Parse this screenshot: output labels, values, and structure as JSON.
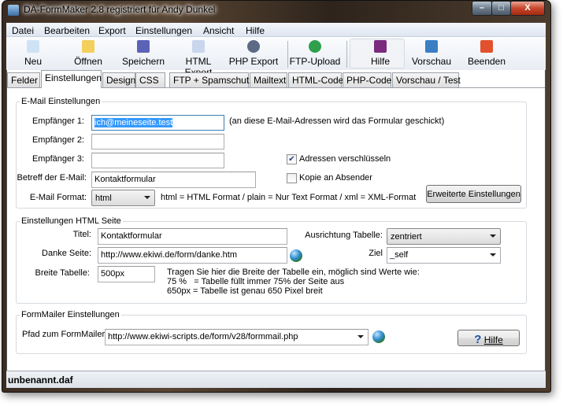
{
  "window": {
    "title": "DA-FormMaker 2.8   registriert für Andy Dunkel",
    "controls": {
      "minimize": "–",
      "maximize": "□",
      "close": "X"
    }
  },
  "menu": [
    "Datei",
    "Bearbeiten",
    "Export",
    "Einstellungen",
    "Ansicht",
    "Hilfe"
  ],
  "toolbar": [
    {
      "label": "Neu",
      "icon": "new-file-icon",
      "color": "#cfe2f5"
    },
    {
      "label": "Öffnen",
      "icon": "open-folder-icon",
      "color": "#f3cf5b"
    },
    {
      "label": "Speichern",
      "icon": "save-disk-icon",
      "color": "#5b63b8"
    },
    {
      "label": "HTML Export",
      "icon": "html-document-icon",
      "color": "#c9d6ee"
    },
    {
      "label": "PHP Export",
      "icon": "php-icon",
      "color": "#5c6a86"
    },
    {
      "label": "FTP-Upload",
      "icon": "upload-globe-icon",
      "color": "#2e9f4a"
    },
    {
      "label": "Hilfe",
      "icon": "help-book-icon",
      "color": "#7a2b7e"
    },
    {
      "label": "Vorschau",
      "icon": "preview-window-icon",
      "color": "#3a7fc4"
    },
    {
      "label": "Beenden",
      "icon": "exit-icon",
      "color": "#e2512d"
    }
  ],
  "tabs": [
    "Felder",
    "Einstellungen",
    "Design",
    "CSS",
    "FTP + Spamschutz",
    "Mailtext",
    "HTML-Code",
    "PHP-Code",
    "Vorschau / Test"
  ],
  "email": {
    "group": "E-Mail Einstellungen",
    "r1_label": "Empfänger 1:",
    "r1_value": "ich@meineseite.test",
    "r1_hint": "(an diese E-Mail-Adressen wird das Formular geschickt)",
    "r2_label": "Empfänger 2:",
    "r2_value": "",
    "r3_label": "Empfänger 3:",
    "r3_value": "",
    "subject_label": "Betreff der E-Mail:",
    "subject_value": "Kontaktformular",
    "format_label": "E-Mail Format:",
    "format_value": "html",
    "format_hint": "html = HTML Format / plain = Nur Text Format / xml = XML-Format",
    "encrypt_label": "Adressen verschlüsseln",
    "encrypt_checked": true,
    "copy_label": "Kopie an Absender",
    "copy_checked": false,
    "advanced_button": "Erweiterte Einstellungen"
  },
  "html": {
    "group": "Einstellungen HTML Seite",
    "title_label": "Titel:",
    "title_value": "Kontaktformular",
    "thanks_label": "Danke Seite:",
    "thanks_value": "http://www.ekiwi.de/form/danke.htm",
    "align_label": "Ausrichtung Tabelle:",
    "align_value": "zentriert",
    "target_label": "Ziel",
    "target_value": "_self",
    "width_label": "Breite Tabelle:",
    "width_value": "500px",
    "width_hint": [
      "Tragen Sie hier die Breite der Tabelle ein, möglich sind Werte wie:",
      "75 %   = Tabelle füllt immer 75% der Seite aus",
      "650px = Tabelle ist genau 650 Pixel breit"
    ]
  },
  "formmailer": {
    "group": "FormMailer Einstellungen",
    "path_label": "Pfad zum FormMailer",
    "path_value": "http://www.ekiwi-scripts.de/form/v28/formmail.php",
    "help_icon": "?",
    "help_button": "Hilfe"
  },
  "status": "unbenannt.daf"
}
